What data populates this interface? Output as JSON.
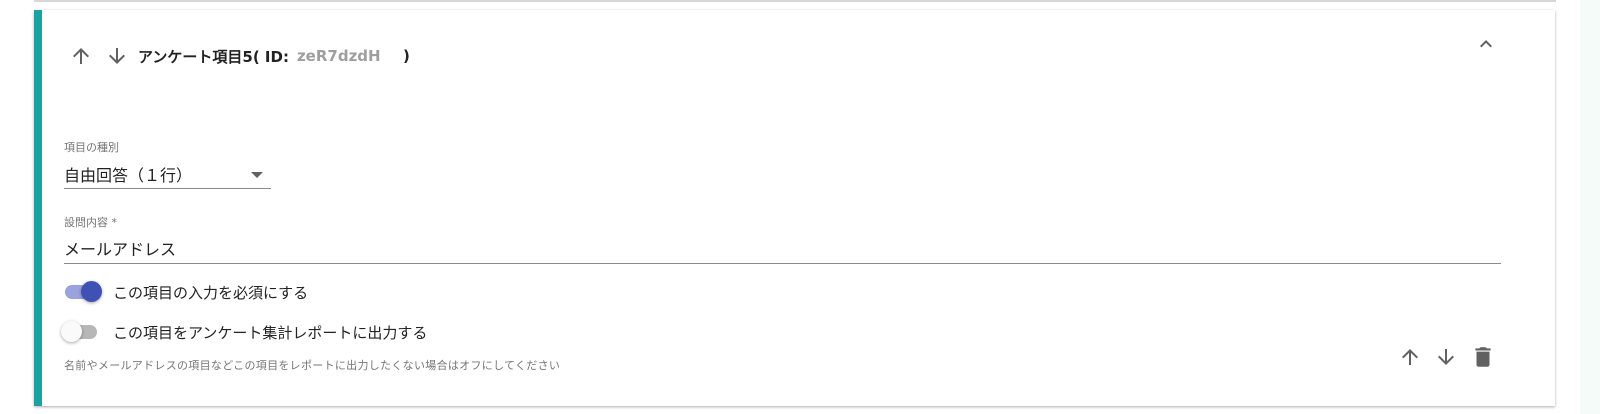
{
  "question": {
    "title_prefix": "アンケート項目5( ID:",
    "id_value": "zeR7dzdH",
    "title_suffix": ")",
    "type_field": {
      "label": "項目の種別",
      "value": "自由回答（１行）"
    },
    "content_field": {
      "label": "設問内容 *",
      "value": "メールアドレス"
    },
    "required_toggle": {
      "label": "この項目の入力を必須にする",
      "checked": true
    },
    "report_toggle": {
      "label": "この項目をアンケート集計レポートに出力する",
      "checked": false
    },
    "helper_text": "名前やメールアドレスの項目などこの項目をレポートに出力したくない場合はオフにしてください"
  },
  "icons": {
    "move_up": "arrow-up-icon",
    "move_down": "arrow-down-icon",
    "collapse": "chevron-up-icon",
    "delete": "trash-icon"
  },
  "colors": {
    "accent": "#1ba1a1",
    "toggle_on": "#3f51b5",
    "toggle_track_on": "#9aa3dd",
    "icon_gray": "#616161"
  }
}
